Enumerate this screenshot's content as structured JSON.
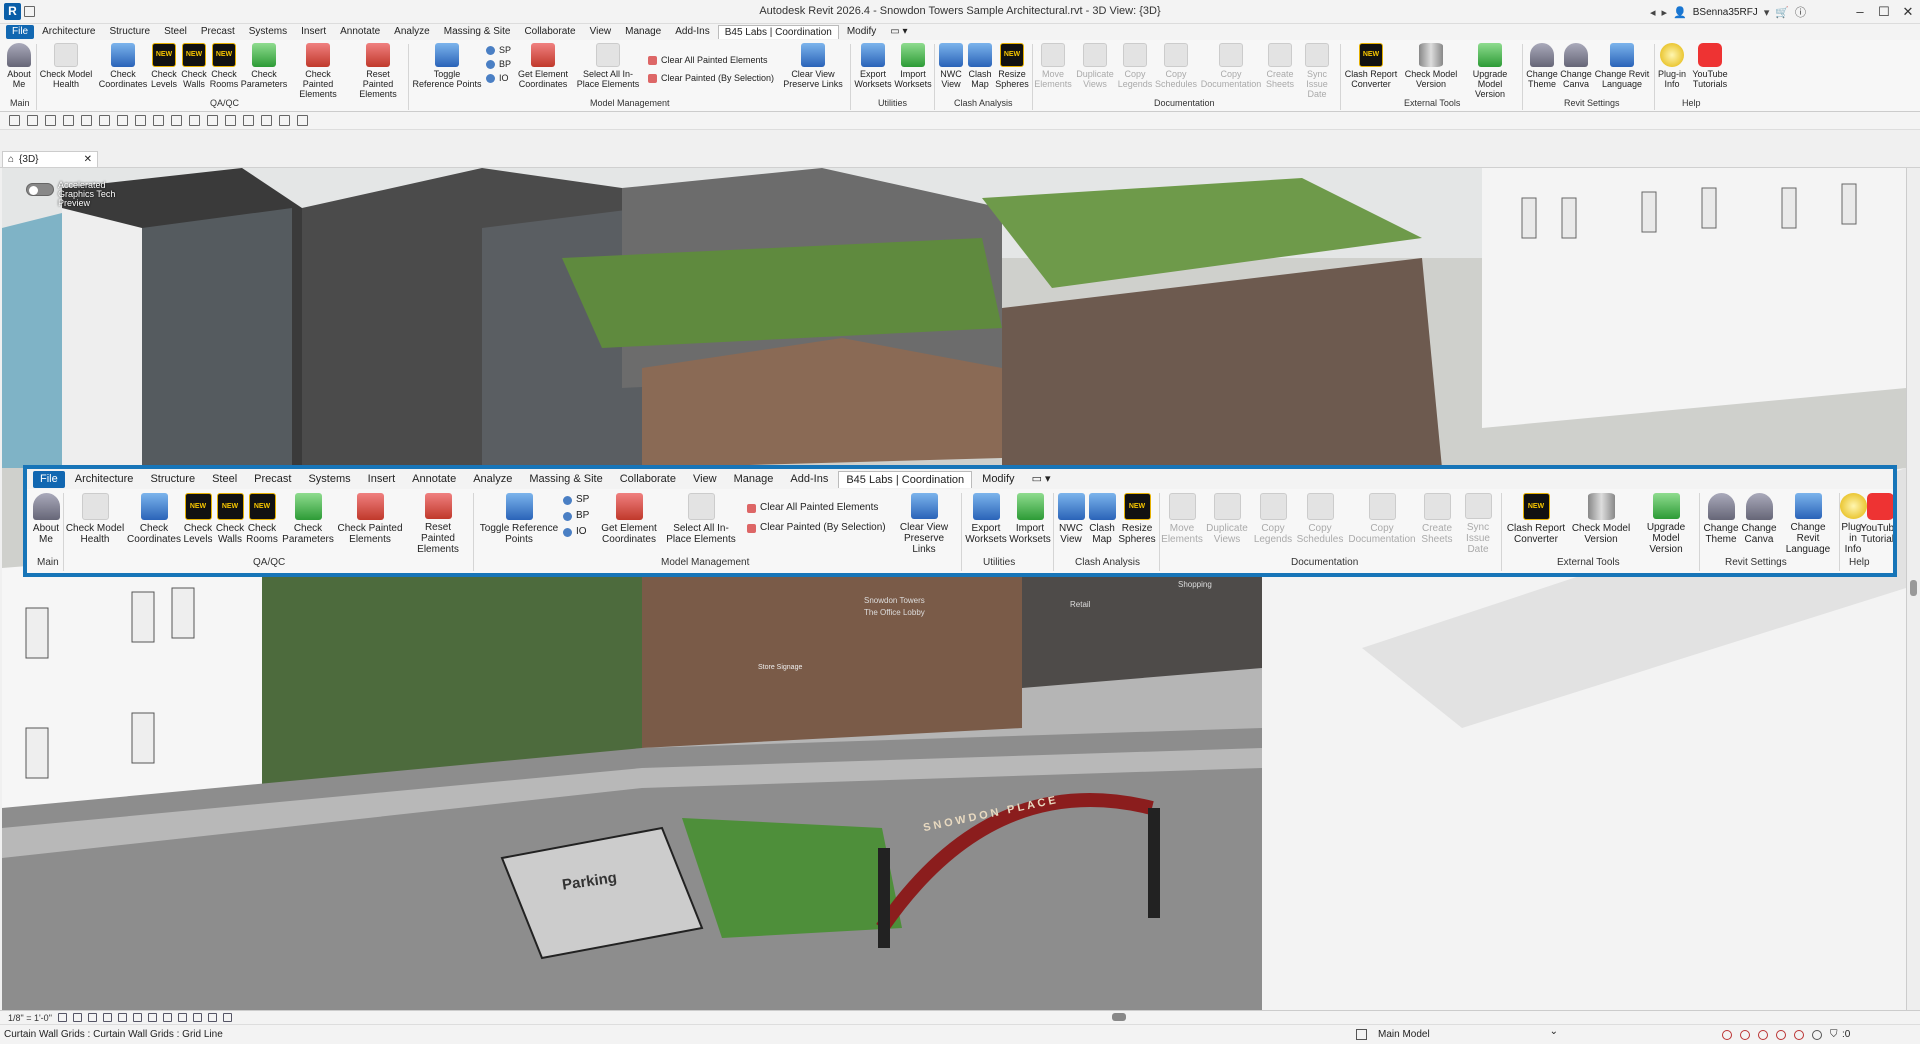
{
  "window": {
    "title": "Autodesk Revit 2026.4 - Snowdon Towers Sample Architectural.rvt - 3D View: {3D}",
    "app_logo": "R",
    "username": "BSenna35RFJ",
    "minimize": "–",
    "maximize": "☐",
    "close": "✕"
  },
  "tabs": [
    "File",
    "Architecture",
    "Structure",
    "Steel",
    "Precast",
    "Systems",
    "Insert",
    "Annotate",
    "Analyze",
    "Massing & Site",
    "Collaborate",
    "View",
    "Manage",
    "Add-Ins",
    "B45 Labs | Coordination",
    "Modify"
  ],
  "tab_dropdown": "▭ ▾",
  "ribbon": {
    "buttons": {
      "about_me": "About Me",
      "check_model_health": "Check Model Health",
      "check_coordinates": "Check Coordinates",
      "check_levels": "Check Levels",
      "check_walls": "Check Walls",
      "check_rooms": "Check Rooms",
      "check_parameters": "Check Parameters",
      "check_painted_elements": "Check Painted Elements",
      "reset_painted_elements": "Reset Painted Elements",
      "toggle_reference_points": "Toggle Reference Points",
      "sp": "SP",
      "bp": "BP",
      "io": "IO",
      "get_element_coordinates": "Get Element Coordinates",
      "select_all_inplace": "Select All In-Place Elements",
      "clear_all_painted": "Clear All Painted Elements",
      "clear_painted_selection": "Clear Painted (By Selection)",
      "clear_view_preserve_links": "Clear View Preserve Links",
      "export_worksets": "Export Worksets",
      "import_worksets": "Import Worksets",
      "nwc_view": "NWC View",
      "clash_map": "Clash Map",
      "resize_spheres": "Resize Spheres",
      "move_elements": "Move Elements",
      "duplicate_views": "Duplicate Views",
      "copy_legends": "Copy Legends",
      "copy_schedules": "Copy Schedules",
      "copy_documentation": "Copy Documentation",
      "create_sheets": "Create Sheets",
      "sync_issue_date": "Sync Issue Date",
      "clash_report_converter": "Clash Report Converter",
      "check_model_version": "Check Model Version",
      "upgrade_model_version": "Upgrade Model Version",
      "change_theme": "Change Theme",
      "change_canva": "Change Canva",
      "change_revit_language": "Change Revit Language",
      "plugin_info": "Plug-in Info",
      "youtube_tutorials": "YouTube Tutorials"
    },
    "new_badge": "NEW",
    "panels": {
      "main": "Main",
      "qaqc": "QA/QC",
      "model_management": "Model Management",
      "utilities": "Utilities",
      "clash_analysis": "Clash Analysis",
      "documentation": "Documentation",
      "external_tools": "External Tools",
      "revit_settings": "Revit Settings",
      "help": "Help"
    }
  },
  "view": {
    "tab_label": "{3D}",
    "tab_close": "✕",
    "toggle_label": "Accelerated Graphics Tech Preview",
    "scene_labels": {
      "parking": "Parking",
      "arch": "SNOWDON PLACE",
      "tower_sign": "Snowdon Towers",
      "lobby_sign": "The Office Lobby",
      "retail_sign": "Retail",
      "shopping_sign": "Shopping",
      "store_sign": "Store Signage"
    }
  },
  "status": {
    "scale": "1/8\" = 1'-0\"",
    "selection_text": "Curtain Wall Grids : Curtain Wall Grids : Grid Line",
    "model": "Main Model",
    "filter_count": ":0"
  },
  "colors": {
    "accent": "#1775b8",
    "file_tab": "#1167b1",
    "new_badge_bg": "#111111",
    "new_badge_text": "#f5c400"
  },
  "icons": [
    "about-me-icon",
    "health-check-icon",
    "coordinates-icon",
    "new-badge-icon",
    "parameters-icon",
    "paint-bucket-icon",
    "toggle-points-icon",
    "cube-icon",
    "workset-icon",
    "clash-icon",
    "documentation-icon",
    "converter-icon",
    "cylinder-icon",
    "theme-icon",
    "info-icon",
    "youtube-icon"
  ]
}
